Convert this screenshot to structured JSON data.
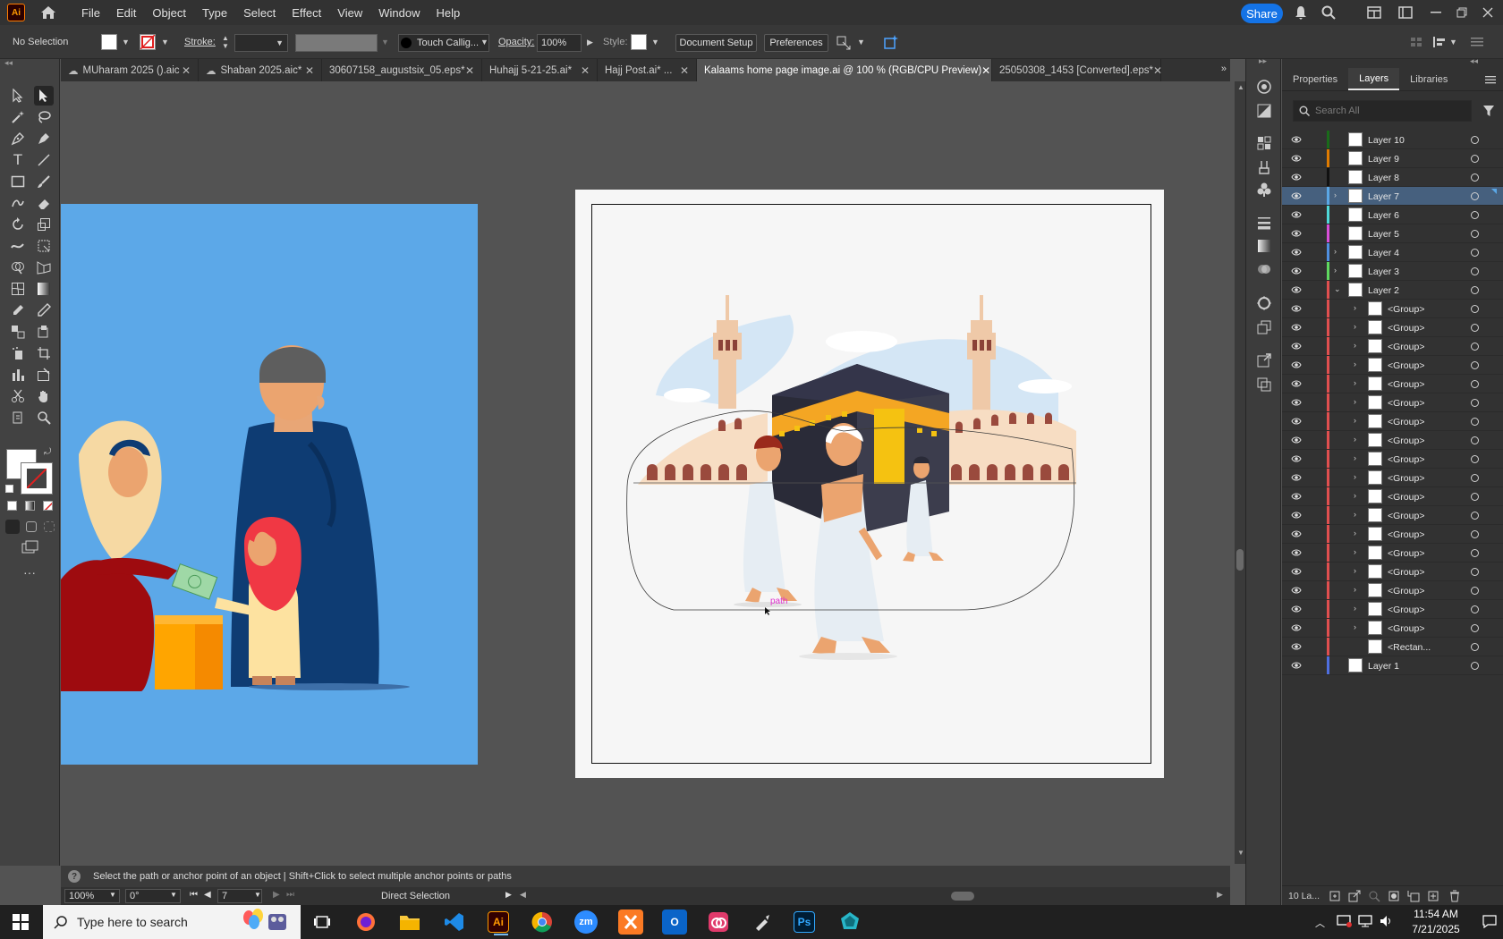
{
  "menubar": {
    "app_logo": "Ai",
    "items": [
      "File",
      "Edit",
      "Object",
      "Type",
      "Select",
      "Effect",
      "View",
      "Window",
      "Help"
    ],
    "share_label": "Share"
  },
  "controlbar": {
    "selection_label": "No Selection",
    "stroke_label": "Stroke:",
    "brush_name": "Touch Callig...",
    "opacity_label": "Opacity:",
    "opacity_value": "100%",
    "style_label": "Style:",
    "document_setup_label": "Document Setup",
    "preferences_label": "Preferences"
  },
  "tabs": [
    {
      "label": "MUharam 2025 ().aic",
      "cloud": true,
      "active": false
    },
    {
      "label": "Shaban 2025.aic*",
      "cloud": true,
      "active": false
    },
    {
      "label": "30607158_augustsix_05.eps*",
      "cloud": false,
      "active": false
    },
    {
      "label": "Huhajj 5-21-25.ai*",
      "cloud": false,
      "active": false
    },
    {
      "label": "Hajj Post.ai* ...",
      "cloud": false,
      "active": false
    },
    {
      "label": "Kalaams home page image.ai @ 100 % (RGB/CPU Preview)",
      "cloud": false,
      "active": true
    },
    {
      "label": "25050308_1453 [Converted].eps*",
      "cloud": false,
      "active": false
    }
  ],
  "canvas": {
    "path_tooltip": "path"
  },
  "hintbar": {
    "text": "Select the path or anchor point of an object  |  Shift+Click to select multiple anchor points or paths"
  },
  "statusbar": {
    "zoom": "100%",
    "rotation": "0°",
    "artboard_number": "7",
    "tool_name": "Direct Selection"
  },
  "layers_panel": {
    "tabs": [
      "Properties",
      "Layers",
      "Libraries"
    ],
    "active_tab": "Layers",
    "search_placeholder": "Search All",
    "footer_count": "10 La...",
    "layers": [
      {
        "name": "Layer 10",
        "color": "#1a6b1a",
        "indent": 0,
        "expandable": false,
        "expanded": false,
        "selected": false
      },
      {
        "name": "Layer 9",
        "color": "#e07b00",
        "indent": 0,
        "expandable": false,
        "expanded": false,
        "selected": false
      },
      {
        "name": "Layer 8",
        "color": "#111111",
        "indent": 0,
        "expandable": false,
        "expanded": false,
        "selected": false
      },
      {
        "name": "Layer 7",
        "color": "#5aa7e6",
        "indent": 0,
        "expandable": true,
        "expanded": false,
        "selected": true
      },
      {
        "name": "Layer 6",
        "color": "#4fd8d8",
        "indent": 0,
        "expandable": false,
        "expanded": false,
        "selected": false
      },
      {
        "name": "Layer 5",
        "color": "#d84fd8",
        "indent": 0,
        "expandable": false,
        "expanded": false,
        "selected": false
      },
      {
        "name": "Layer 4",
        "color": "#4f8fe0",
        "indent": 0,
        "expandable": true,
        "expanded": false,
        "selected": false
      },
      {
        "name": "Layer 3",
        "color": "#5fd85f",
        "indent": 0,
        "expandable": true,
        "expanded": false,
        "selected": false
      },
      {
        "name": "Layer 2",
        "color": "#e04f4f",
        "indent": 0,
        "expandable": true,
        "expanded": true,
        "selected": false
      },
      {
        "name": "<Group>",
        "color": "#e04f4f",
        "indent": 1,
        "expandable": true,
        "expanded": false,
        "selected": false
      },
      {
        "name": "<Group>",
        "color": "#e04f4f",
        "indent": 1,
        "expandable": true,
        "expanded": false,
        "selected": false
      },
      {
        "name": "<Group>",
        "color": "#e04f4f",
        "indent": 1,
        "expandable": true,
        "expanded": false,
        "selected": false
      },
      {
        "name": "<Group>",
        "color": "#e04f4f",
        "indent": 1,
        "expandable": true,
        "expanded": false,
        "selected": false
      },
      {
        "name": "<Group>",
        "color": "#e04f4f",
        "indent": 1,
        "expandable": true,
        "expanded": false,
        "selected": false
      },
      {
        "name": "<Group>",
        "color": "#e04f4f",
        "indent": 1,
        "expandable": true,
        "expanded": false,
        "selected": false
      },
      {
        "name": "<Group>",
        "color": "#e04f4f",
        "indent": 1,
        "expandable": true,
        "expanded": false,
        "selected": false
      },
      {
        "name": "<Group>",
        "color": "#e04f4f",
        "indent": 1,
        "expandable": true,
        "expanded": false,
        "selected": false
      },
      {
        "name": "<Group>",
        "color": "#e04f4f",
        "indent": 1,
        "expandable": true,
        "expanded": false,
        "selected": false
      },
      {
        "name": "<Group>",
        "color": "#e04f4f",
        "indent": 1,
        "expandable": true,
        "expanded": false,
        "selected": false
      },
      {
        "name": "<Group>",
        "color": "#e04f4f",
        "indent": 1,
        "expandable": true,
        "expanded": false,
        "selected": false
      },
      {
        "name": "<Group>",
        "color": "#e04f4f",
        "indent": 1,
        "expandable": true,
        "expanded": false,
        "selected": false
      },
      {
        "name": "<Group>",
        "color": "#e04f4f",
        "indent": 1,
        "expandable": true,
        "expanded": false,
        "selected": false
      },
      {
        "name": "<Group>",
        "color": "#e04f4f",
        "indent": 1,
        "expandable": true,
        "expanded": false,
        "selected": false
      },
      {
        "name": "<Group>",
        "color": "#e04f4f",
        "indent": 1,
        "expandable": true,
        "expanded": false,
        "selected": false
      },
      {
        "name": "<Group>",
        "color": "#e04f4f",
        "indent": 1,
        "expandable": true,
        "expanded": false,
        "selected": false
      },
      {
        "name": "<Group>",
        "color": "#e04f4f",
        "indent": 1,
        "expandable": true,
        "expanded": false,
        "selected": false
      },
      {
        "name": "<Group>",
        "color": "#e04f4f",
        "indent": 1,
        "expandable": true,
        "expanded": false,
        "selected": false
      },
      {
        "name": "<Rectan...",
        "color": "#e04f4f",
        "indent": 1,
        "expandable": false,
        "expanded": false,
        "selected": false
      },
      {
        "name": "Layer 1",
        "color": "#4f6fe0",
        "indent": 0,
        "expandable": false,
        "expanded": false,
        "selected": false
      }
    ]
  },
  "taskbar": {
    "search_placeholder": "Type here to search",
    "time": "11:54 AM",
    "date": "7/21/2025",
    "apps": [
      "Task View",
      "Firefox",
      "File Explorer",
      "VS Code",
      "Illustrator",
      "Chrome",
      "Zoom",
      "XAMPP",
      "Outlook",
      "Creative Cloud",
      "Pen tool",
      "Photoshop",
      "Other app"
    ]
  }
}
